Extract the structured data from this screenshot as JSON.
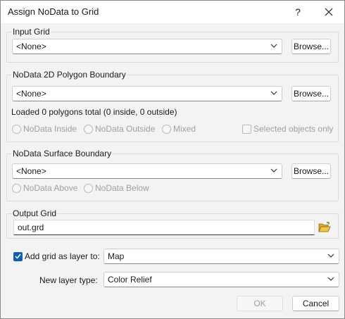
{
  "window": {
    "title": "Assign NoData to Grid",
    "help": "?"
  },
  "input_grid": {
    "label": "Input Grid",
    "value": "<None>",
    "browse": "Browse..."
  },
  "polygon_boundary": {
    "label": "NoData 2D Polygon Boundary",
    "value": "<None>",
    "browse": "Browse...",
    "status": "Loaded 0 polygons total (0 inside, 0 outside)",
    "options": [
      "NoData Inside",
      "NoData Outside",
      "Mixed"
    ],
    "selected_objects_only": "Selected objects only"
  },
  "surface_boundary": {
    "label": "NoData Surface Boundary",
    "value": "<None>",
    "browse": "Browse...",
    "options": [
      "NoData Above",
      "NoData Below"
    ]
  },
  "output_grid": {
    "label": "Output Grid",
    "value": "out.grd",
    "folder_icon": "folder-open-icon"
  },
  "layer": {
    "add_label": "Add grid as layer to:",
    "add_checked": true,
    "target": "Map",
    "type_label": "New layer type:",
    "type_value": "Color Relief"
  },
  "buttons": {
    "ok": "OK",
    "cancel": "Cancel"
  },
  "colors": {
    "accent": "#1160b0",
    "dialog_bg": "#f3f3f3",
    "disabled_text": "#a0a0a0"
  }
}
